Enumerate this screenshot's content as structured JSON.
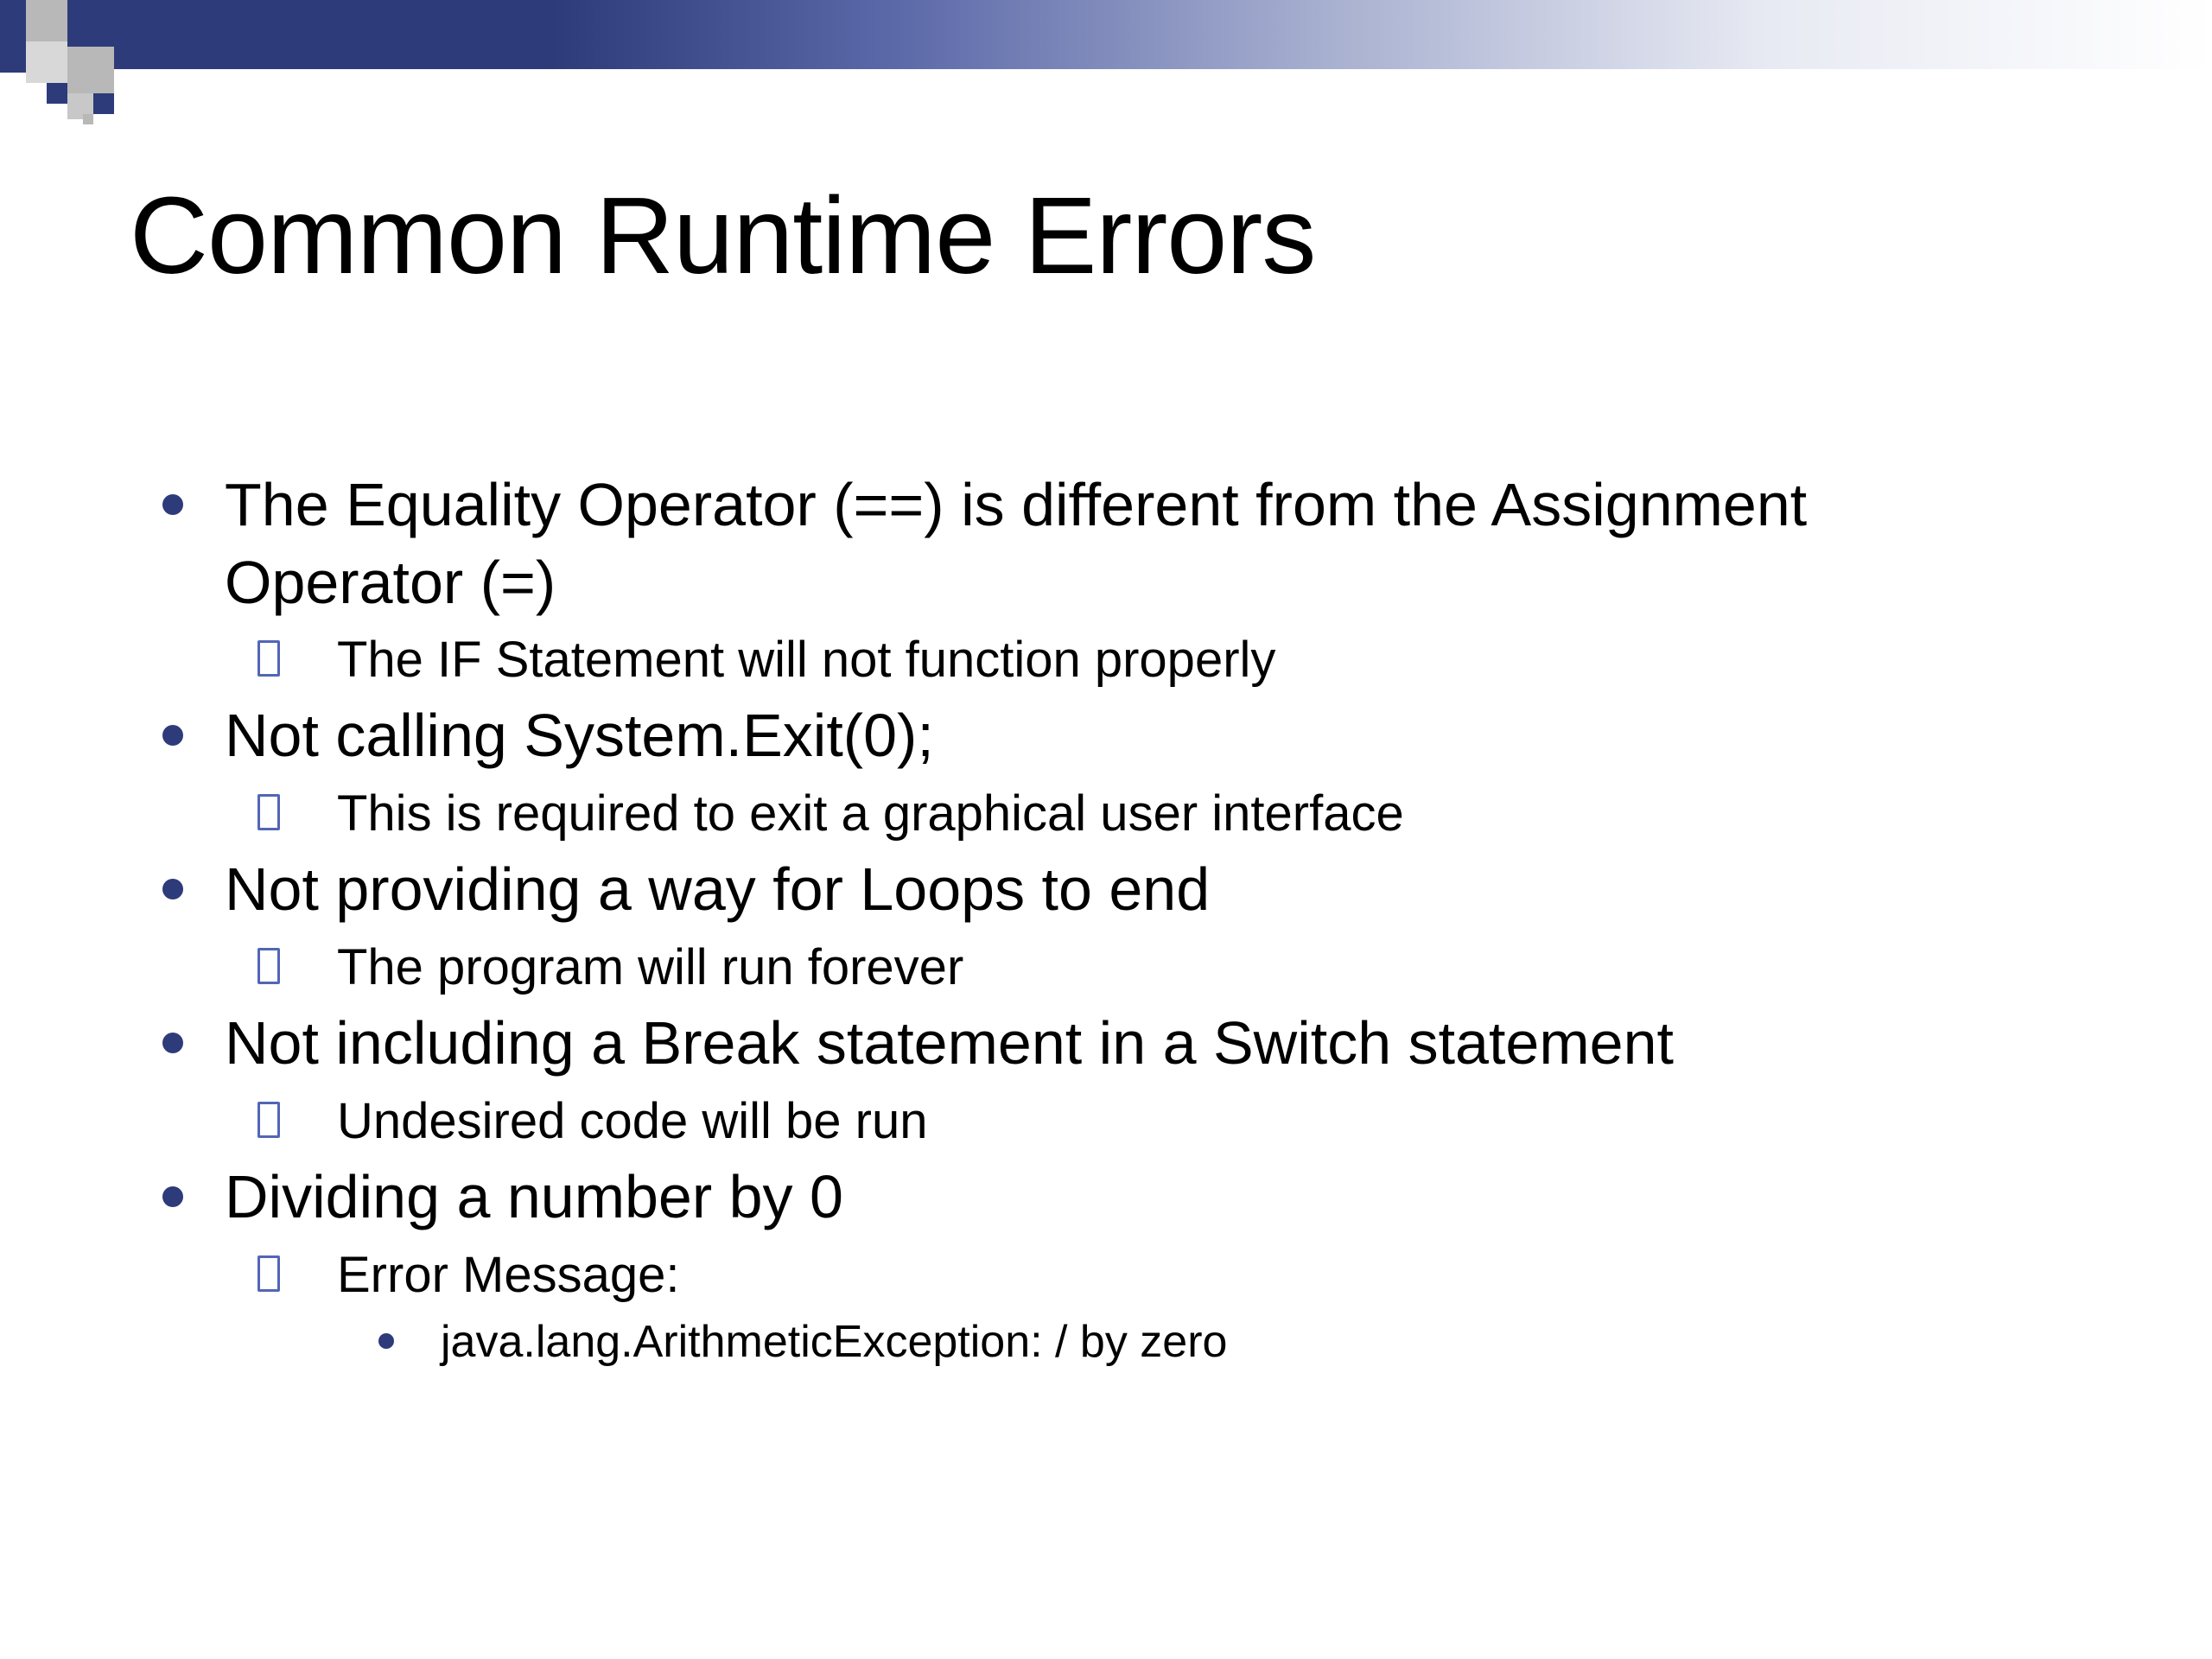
{
  "title": "Common Runtime Errors",
  "bullets": [
    {
      "text": "The Equality Operator (==) is different from the Assignment Operator (=)",
      "sub": [
        {
          "text": "The IF Statement will not function properly"
        }
      ]
    },
    {
      "text": "Not calling System.Exit(0);",
      "sub": [
        {
          "text": "This is required to exit a graphical user interface"
        }
      ]
    },
    {
      "text": "Not providing a way for Loops to end",
      "sub": [
        {
          "text": "The program will run forever"
        }
      ]
    },
    {
      "text": "Not including a Break statement in a Switch statement",
      "sub": [
        {
          "text": "Undesired code will be run"
        }
      ]
    },
    {
      "text": "Dividing a number by 0",
      "sub": [
        {
          "text": "Error Message:",
          "sub": [
            {
              "text": "java.lang.ArithmeticException: / by zero"
            }
          ]
        }
      ]
    }
  ]
}
